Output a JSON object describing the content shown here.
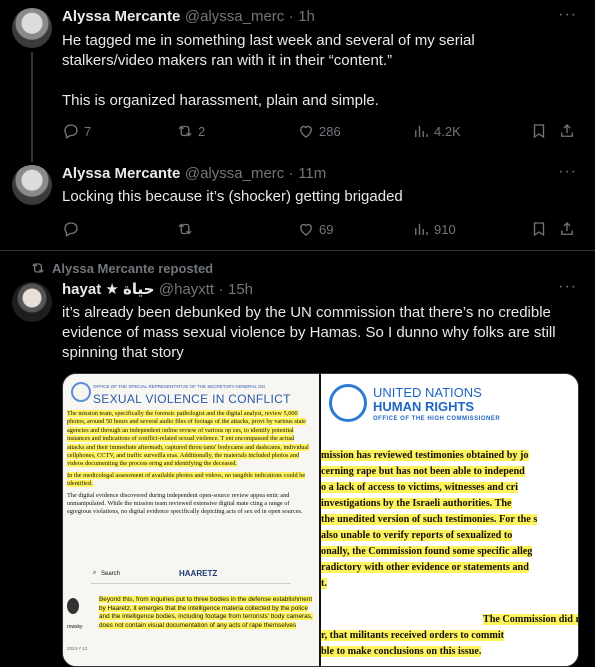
{
  "tweets": [
    {
      "author_name": "Alyssa Mercante",
      "author_handle": "@alyssa_merc",
      "time": "1h",
      "text_lines": [
        "He tagged me in something last week and several of my serial",
        "stalkers/video makers ran with it in their “content.”",
        "",
        "This is organized harassment, plain and simple."
      ],
      "replies": "7",
      "reposts": "2",
      "likes": "286",
      "views": "4.2K"
    },
    {
      "author_name": "Alyssa Mercante",
      "author_handle": "@alyssa_merc",
      "time": "11m",
      "text_lines": [
        "Locking this because it’s (shocker) getting brigaded"
      ],
      "replies": "",
      "reposts": "",
      "likes": "69",
      "views": "910"
    },
    {
      "repost_label": "Alyssa Mercante reposted",
      "author_name": "hayat ★ حياة",
      "author_handle": "@hayxtt",
      "time": "15h",
      "text_lines": [
        "it’s already been debunked by the UN commission that there’s no credible",
        "evidence of mass sexual violence by Hamas. So I dunno why folks are still",
        "spinning that story"
      ]
    }
  ],
  "separator": "·",
  "more_label": "···",
  "media_left": {
    "org_line": "OFFICE OF THE SPECIAL REPRESENTATIVE OF THE SECRETARY-GENERAL ON",
    "title": "SEXUAL VIOLENCE IN CONFLICT",
    "para1": "The mission team, specifically the forensic pathologist and the digital analyst, review 5,000 photos, around 50 hours and several audio files of footage of the attacks, provi by various state agencies and through an independent online review of various op ces, to identify potential instances and indications of conflict-related sexual violence. T ent encompassed the actual attacks and their immediate aftermath, captured throu tants' bodycams and dashcams, individual cellphones, CCTV, and traffic surveilla eras. Additionally, the materials included photos and videos documenting the process ering and identifying the deceased.",
    "para2": "In the medicolegal assessment of available photos and videos, no tangible indications could be identified.",
    "para3": "The digital evidence discovered during independent open-source review appea entic and unmanipulated. While the mission team reviewed extensive digital mate cting a range of egregious violations, no digital evidence specifically depicting acts of sex ed in open sources.",
    "search_label": "Search",
    "brand": "HAARETZ",
    "para4": "Beyond this, from inquiries put to three bodies in the defense establishment by Haaretz, it emerges that the intelligence materia collected by the police and the intelligence bodies, including footage from terrorists' body cameras, does not contain visual documentation of any acts of rape themselves",
    "side_text": "rowsky",
    "date_text": "2024-7-12"
  },
  "media_right": {
    "title_line1": "UNITED NATIONS",
    "title_line2": "HUMAN RIGHTS",
    "subtitle": "OFFICE OF THE HIGH COMMISSIONER",
    "lines": [
      "mission has reviewed testimonies obtained by jo",
      "cerning rape but has not been able to independ",
      "o a lack of access to victims, witnesses and cri",
      " investigations by the Israeli authorities. The",
      "the unedited version of such testimonies. For the s",
      " also unable to verify reports of sexualized to",
      "onally, the Commission found some specific alleg",
      "radictory with other evidence or statements and",
      "t."
    ],
    "lines2": [
      "The Commission did r",
      "r, that militants received orders to commit",
      "ble to make conclusions on this issue."
    ]
  },
  "colors": {
    "background": "#000000",
    "text": "#e7e9ea",
    "muted": "#71767b",
    "divider": "#2f3336",
    "highlight": "#fff35c"
  }
}
